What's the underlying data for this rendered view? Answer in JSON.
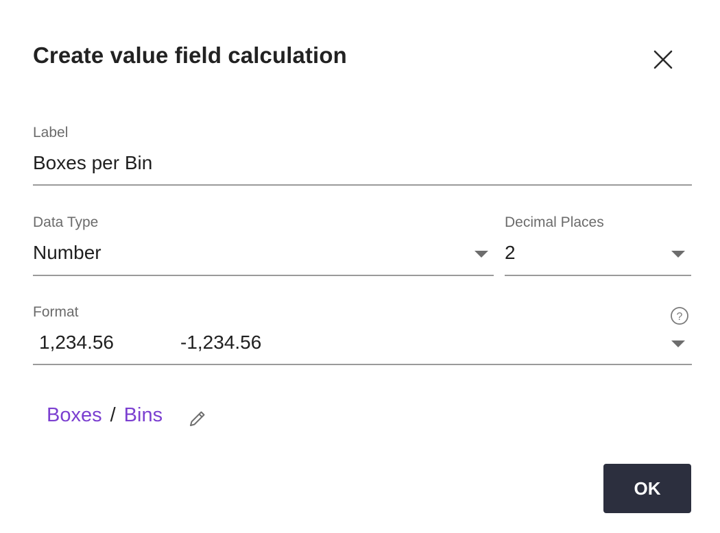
{
  "dialog": {
    "title": "Create value field calculation",
    "close_icon": "close-icon"
  },
  "label_field": {
    "label": "Label",
    "value": "Boxes per Bin"
  },
  "data_type_field": {
    "label": "Data Type",
    "value": "Number"
  },
  "decimal_places_field": {
    "label": "Decimal Places",
    "value": "2"
  },
  "format_field": {
    "label": "Format",
    "positive_example": "1,234.56",
    "negative_example": "-1,234.56",
    "help_icon": "help-circle-icon"
  },
  "formula": {
    "numerator": "Boxes",
    "separator": "/",
    "denominator": "Bins",
    "edit_icon": "pencil-icon"
  },
  "actions": {
    "ok_label": "OK"
  },
  "colors": {
    "accent_link": "#7b3fd0",
    "primary_button": "#2c2f3e"
  }
}
